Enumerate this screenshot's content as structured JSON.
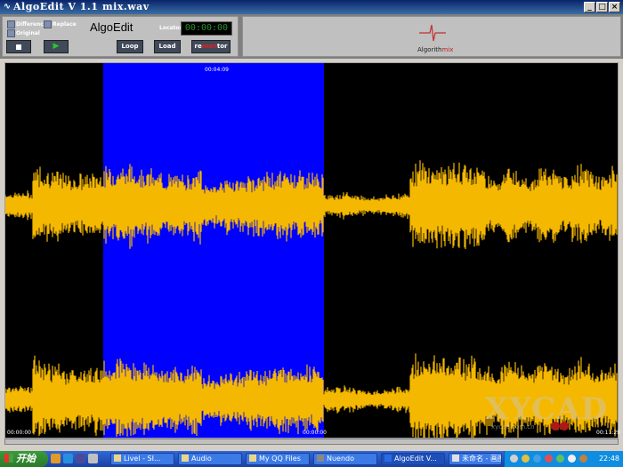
{
  "window": {
    "title": "AlgoEdit V 1.1",
    "filename": "mix.wav",
    "app_icon": "algoedit-logo-icon",
    "controls": [
      "minimize-icon",
      "maximize-icon",
      "close-icon"
    ]
  },
  "toolbar": {
    "options": {
      "difference": "Difference",
      "replace": "Replace",
      "original": "Original"
    },
    "app_name": "AlgoEdit",
    "locator_label": "Locator",
    "locator_time": "00:00:00",
    "stop_icon": "stop-icon",
    "play_icon": "play-icon",
    "loop": "Loop",
    "load": "Load",
    "render_prefix": "re",
    "render_mid": "mon",
    "render_suffix": "tor",
    "brand_prefix": "Algorith",
    "brand_suffix": "mix",
    "brand_icon": "heartbeat-logo-icon"
  },
  "waveform": {
    "selection_start_label": "00:04:09",
    "start_time": "00:00:00",
    "selection_end_label": "00:00:00",
    "end_time": "00:11:29",
    "selection_start_fraction": 0.16,
    "selection_end_fraction": 0.52,
    "colors": {
      "background": "#000000",
      "wave": "#f5b800",
      "selection": "#0000ff"
    }
  },
  "watermark": {
    "text": "XYCAD",
    "sub": "xycad.com.cn"
  },
  "taskbar": {
    "start": "开始",
    "tasks": [
      "Livel - SI...",
      "Audio",
      "My QQ Files",
      "Nuendo",
      "AlgoEdit V...",
      "未命名 - 画图"
    ],
    "active_task_index": 4,
    "clock": "22:48"
  }
}
